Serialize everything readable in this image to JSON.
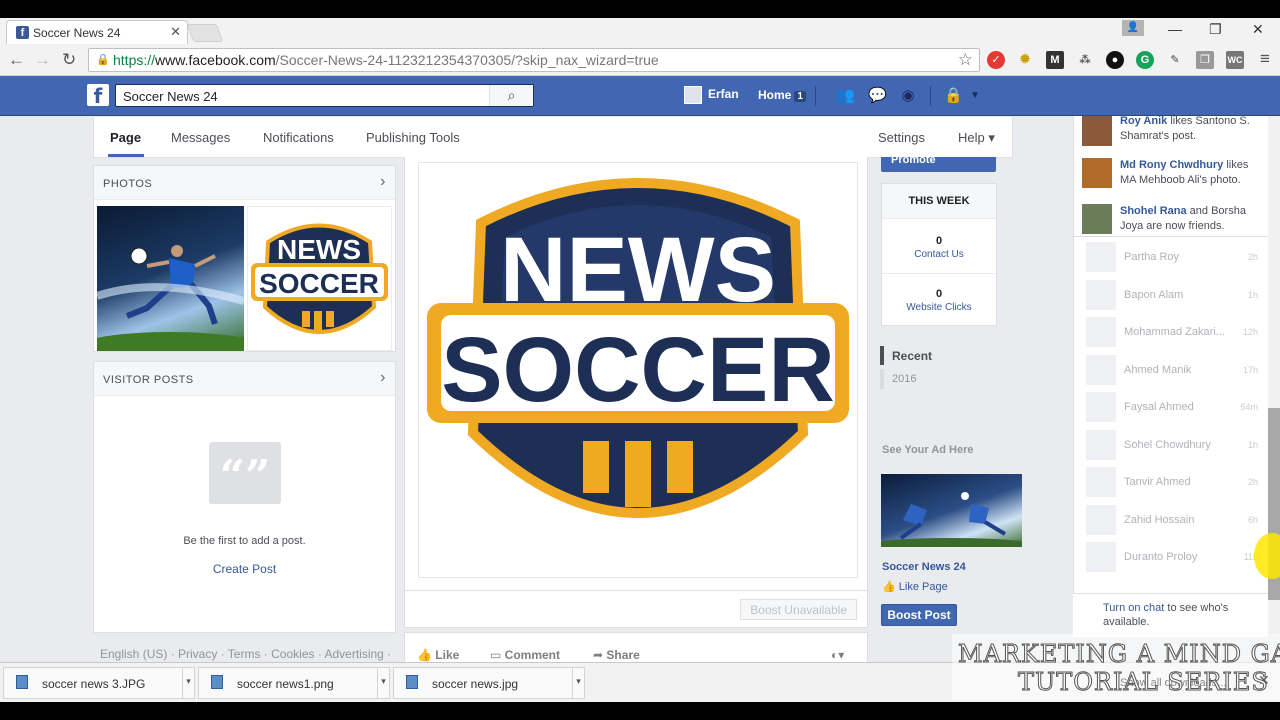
{
  "browser": {
    "tab_title": "Soccer News 24",
    "url_scheme": "https://",
    "url_host": "www.facebook.com",
    "url_path": "/Soccer-News-24-1123212354370305/?skip_nax_wizard=true"
  },
  "fb_header": {
    "search_value": "Soccer News 24",
    "user_name": "Erfan",
    "home_label": "Home",
    "home_count": "1"
  },
  "page_nav": {
    "tabs": [
      "Page",
      "Messages",
      "Notifications",
      "Publishing Tools"
    ],
    "settings": "Settings",
    "help": "Help ▾"
  },
  "photos": {
    "title": "PHOTOS",
    "logo_line1": "NEWS",
    "logo_line2": "SOCCER"
  },
  "visitor_posts": {
    "title": "VISITOR POSTS",
    "empty_text": "Be the first to add a post.",
    "create_link": "Create Post"
  },
  "footer_links": "English (US) · Privacy · Terms · Cookies · Advertising ·",
  "post": {
    "logo_line1": "NEWS",
    "logo_line2": "SOCCER",
    "boost_unavailable": "Boost Unavailable",
    "like": "Like",
    "comment": "Comment",
    "share": "Share"
  },
  "right": {
    "promote": "Promote",
    "this_week": "THIS WEEK",
    "contact_count": "0",
    "contact_label": "Contact Us",
    "clicks_count": "0",
    "clicks_label": "Website Clicks",
    "recent": "Recent",
    "year": "2016",
    "ad_header": "See Your Ad Here",
    "ad_title": "Soccer News 24",
    "like_page": "Like Page",
    "boost_post": "Boost Post"
  },
  "ticker": [
    {
      "name": "Roy Anik",
      "rest": " likes Santono S. Shamrat's post."
    },
    {
      "name": "Md Rony Chwdhury",
      "rest": " likes MA Mehboob Ali's photo."
    },
    {
      "name": "Shohel Rana",
      "rest": " and Borsha Joya are now friends."
    }
  ],
  "chat": [
    {
      "name": "Partha Roy",
      "time": "2h"
    },
    {
      "name": "Bapon Alam",
      "time": "1h"
    },
    {
      "name": "Mohammad Zakari...",
      "time": "12h"
    },
    {
      "name": "Ahmed Manik",
      "time": "17h"
    },
    {
      "name": "Faysal Ahmed",
      "time": "54m"
    },
    {
      "name": "Sohel Chowdhury",
      "time": "1h"
    },
    {
      "name": "Tanvir Ahmed",
      "time": "2h"
    },
    {
      "name": "Zahid Hossain",
      "time": "6h"
    },
    {
      "name": "Duranto Proloy",
      "time": "11h"
    }
  ],
  "turn_on_chat": {
    "link": "Turn on chat",
    "rest": " to see who's available."
  },
  "downloads": [
    "soccer news 3.JPG",
    "soccer news1.png",
    "soccer news.jpg"
  ],
  "show_all": "Show all downloads...",
  "watermark": {
    "line1": "MARKETING A MIND GAME",
    "line2": "TUTORIAL SERIES"
  }
}
